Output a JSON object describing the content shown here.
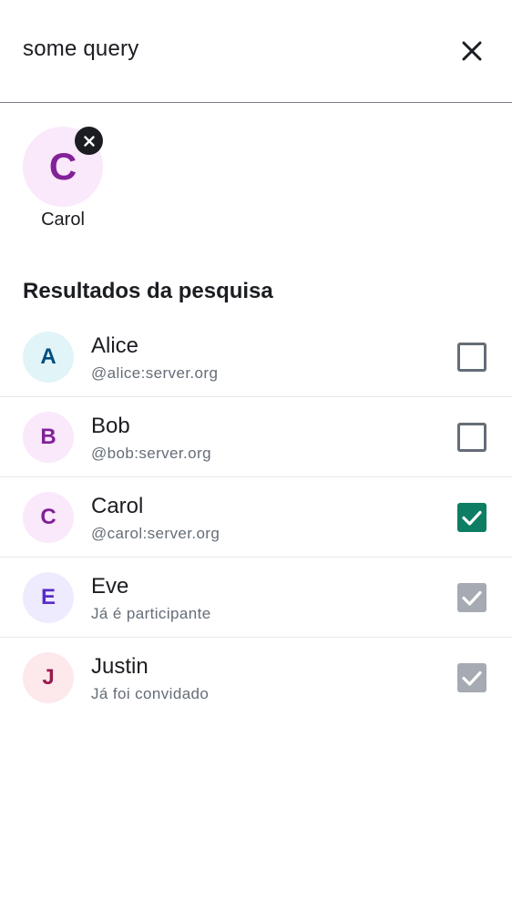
{
  "search": {
    "value": "some query"
  },
  "selected": [
    {
      "initial": "C",
      "name": "Carol",
      "avatar_bg": "#fae8fb",
      "avatar_fg": "#822198"
    }
  ],
  "section_title": "Resultados da pesquisa",
  "results": [
    {
      "initial": "A",
      "name": "Alice",
      "subtitle": "@alice:server.org",
      "state": "unchecked",
      "avatar_bg": "#e1f4f8",
      "avatar_fg": "#004d80"
    },
    {
      "initial": "B",
      "name": "Bob",
      "subtitle": "@bob:server.org",
      "state": "unchecked",
      "avatar_bg": "#fae8fb",
      "avatar_fg": "#822198"
    },
    {
      "initial": "C",
      "name": "Carol",
      "subtitle": "@carol:server.org",
      "state": "checked",
      "avatar_bg": "#fae8fb",
      "avatar_fg": "#822198"
    },
    {
      "initial": "E",
      "name": "Eve",
      "subtitle": "Já é participante",
      "state": "disabled",
      "avatar_bg": "#efebfe",
      "avatar_fg": "#5a2bc7"
    },
    {
      "initial": "J",
      "name": "Justin",
      "subtitle": "Já foi convidado",
      "state": "disabled",
      "avatar_bg": "#fde8ec",
      "avatar_fg": "#9c1a4c"
    }
  ],
  "colors": {
    "accent_green": "#0d7d63",
    "disabled_gray": "#a6aab2",
    "text_primary": "#1b1d22",
    "text_secondary": "#656d77"
  },
  "icons": {
    "close": "close-icon",
    "remove": "close-small-icon",
    "check": "checkmark-icon"
  }
}
